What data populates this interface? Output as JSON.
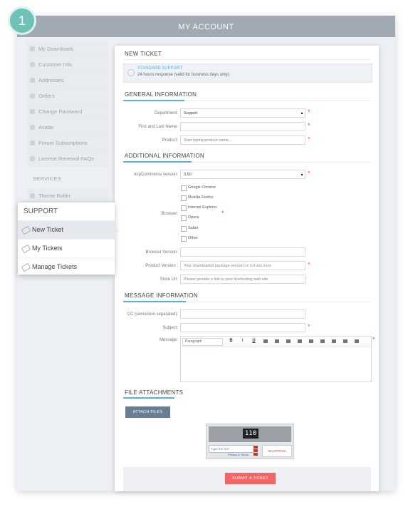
{
  "step_number": "1",
  "header": {
    "title": "MY ACCOUNT"
  },
  "sidebar": {
    "items": [
      {
        "label": "My Downloads"
      },
      {
        "label": "Customer Info"
      },
      {
        "label": "Addresses"
      },
      {
        "label": "Orders"
      },
      {
        "label": "Change Password"
      },
      {
        "label": "Avatar"
      },
      {
        "label": "Forum Subscriptions"
      },
      {
        "label": "License Renewal FAQs"
      }
    ],
    "services_heading": "SERVICES",
    "services_items": [
      {
        "label": "Theme Roller"
      }
    ]
  },
  "support_menu": {
    "heading": "SUPPORT",
    "items": [
      {
        "label": "New Ticket",
        "active": true
      },
      {
        "label": "My Tickets",
        "active": false
      },
      {
        "label": "Manage Tickets",
        "active": false
      }
    ]
  },
  "ticket": {
    "title": "NEW TICKET",
    "support_type": "STANDARD SUPPORT",
    "support_desc": "24 hours response (valid for business days only)",
    "general_heading": "GENERAL INFORMATION",
    "department_label": "Department:",
    "department_value": "Support",
    "name_label": "First and Last Name:",
    "name_value": "",
    "product_label": "Product:",
    "product_placeholder": "Start typing product name...",
    "additional_heading": "ADDITIONAL INFORMATION",
    "nop_label": "nopCommerce version:",
    "nop_value": "3.50",
    "browser_label": "Browser:",
    "browsers": [
      {
        "label": "Google Chrome",
        "checked": false
      },
      {
        "label": "Mozilla Firefox",
        "checked": false
      },
      {
        "label": "Internet Explorer",
        "checked": false
      },
      {
        "label": "Opera",
        "checked": false
      },
      {
        "label": "Safari",
        "checked": false
      },
      {
        "label": "Other",
        "checked": false
      }
    ],
    "browser_version_label": "Browser Version:",
    "browser_version_value": "",
    "product_version_label": "Product Version :",
    "product_version_placeholder": "Your downloaded package version i.e 3.4.xxx.xxxx",
    "store_url_label": "Store Url:",
    "store_url_placeholder": "Please provide a link to your live/testing web site",
    "message_heading": "MESSAGE INFORMATION",
    "cc_label": "CC (semicolon separated):",
    "cc_value": "",
    "subject_label": "Subject:",
    "subject_value": "",
    "message_label": "Message:",
    "editor_format": "Paragraph",
    "editor_tools": {
      "bold": "B",
      "italic": "I",
      "underline": "U"
    },
    "attachments_heading": "FILE ATTACHMENTS",
    "attach_button": "ATTACH FILES",
    "captcha": {
      "number": "110",
      "input_placeholder": "Type the text",
      "links": "Privacy & Terms",
      "logo": "reCAPTCHA"
    },
    "submit_button": "SUBMIT A TICKET",
    "required_mark": "*"
  },
  "colors": {
    "accent": "#5ab0d9",
    "submit": "#f16565",
    "attach": "#6b7d92",
    "badge": "#6ec2b6"
  }
}
